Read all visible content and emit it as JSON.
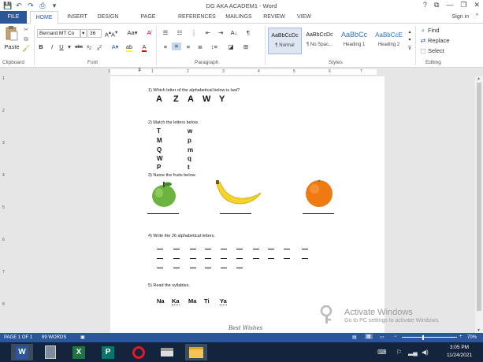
{
  "window": {
    "title": "DG AKA ACADEM1 - Word",
    "controls": [
      "?",
      "⧉",
      "—",
      "❐",
      "✕"
    ]
  },
  "qat": [
    "💾",
    "↶",
    "↷",
    "⎙",
    "▾"
  ],
  "tabs": [
    "FILE",
    "HOME",
    "INSERT",
    "DESIGN",
    "PAGE LAYOUT",
    "REFERENCES",
    "MAILINGS",
    "REVIEW",
    "VIEW"
  ],
  "signin": "Sign in",
  "ribbon": {
    "clipboard": {
      "paste": "Paste",
      "label": "Clipboard"
    },
    "font": {
      "name": "Bernard MT Co",
      "size": "36",
      "label": "Font"
    },
    "paragraph": {
      "label": "Paragraph"
    },
    "styles": {
      "label": "Styles",
      "items": [
        {
          "sample": "AaBbCcDc",
          "name": "¶ Normal"
        },
        {
          "sample": "AaBbCcDc",
          "name": "¶ No Spac..."
        },
        {
          "sample": "AaBbCc",
          "name": "Heading 1"
        },
        {
          "sample": "AaBbCcE",
          "name": "Heading 2"
        }
      ]
    },
    "editing": {
      "find": "Find",
      "replace": "Replace",
      "select": "Select",
      "label": "Editing"
    }
  },
  "ruler": {
    "numbers": [
      "1",
      "1",
      "2",
      "3",
      "4",
      "5",
      "6",
      "7"
    ],
    "vnumbers": [
      "1",
      "2",
      "3",
      "4",
      "5",
      "6",
      "7",
      "8"
    ]
  },
  "document": {
    "q1": {
      "text": "1)    Which letter of the alphabetical below is last?",
      "letters": [
        "A",
        "Z",
        "A",
        "W",
        "Y"
      ]
    },
    "q2": {
      "text": "2)    Match the letters below.",
      "left": [
        "T",
        "M",
        "Q",
        "W",
        "P"
      ],
      "right": [
        "w",
        "p",
        "m",
        "q",
        "t"
      ]
    },
    "q3": {
      "text": "3)    Name the fruits below."
    },
    "q4": {
      "text": "4)    Write the 26 alphabetical letters."
    },
    "q5": {
      "text": "5)    Read the syllables.",
      "syllables": [
        "Na",
        "Ka",
        "Ma",
        "Ti",
        "Ya"
      ]
    },
    "footer_script": "Best Wishes"
  },
  "watermark": {
    "title": "Activate Windows",
    "subtitle": "Go to PC settings to activate Windows."
  },
  "status": {
    "page": "PAGE 1 OF 1",
    "words": "89 WORDS",
    "zoom": "70%"
  },
  "taskbar": {
    "time": "3:05 PM",
    "date": "11/24/2021",
    "apps": [
      "W",
      "",
      "X",
      "P",
      "O",
      "",
      ""
    ]
  },
  "colors": {
    "accent": "#2b579a",
    "taskbar": "#14243c"
  }
}
